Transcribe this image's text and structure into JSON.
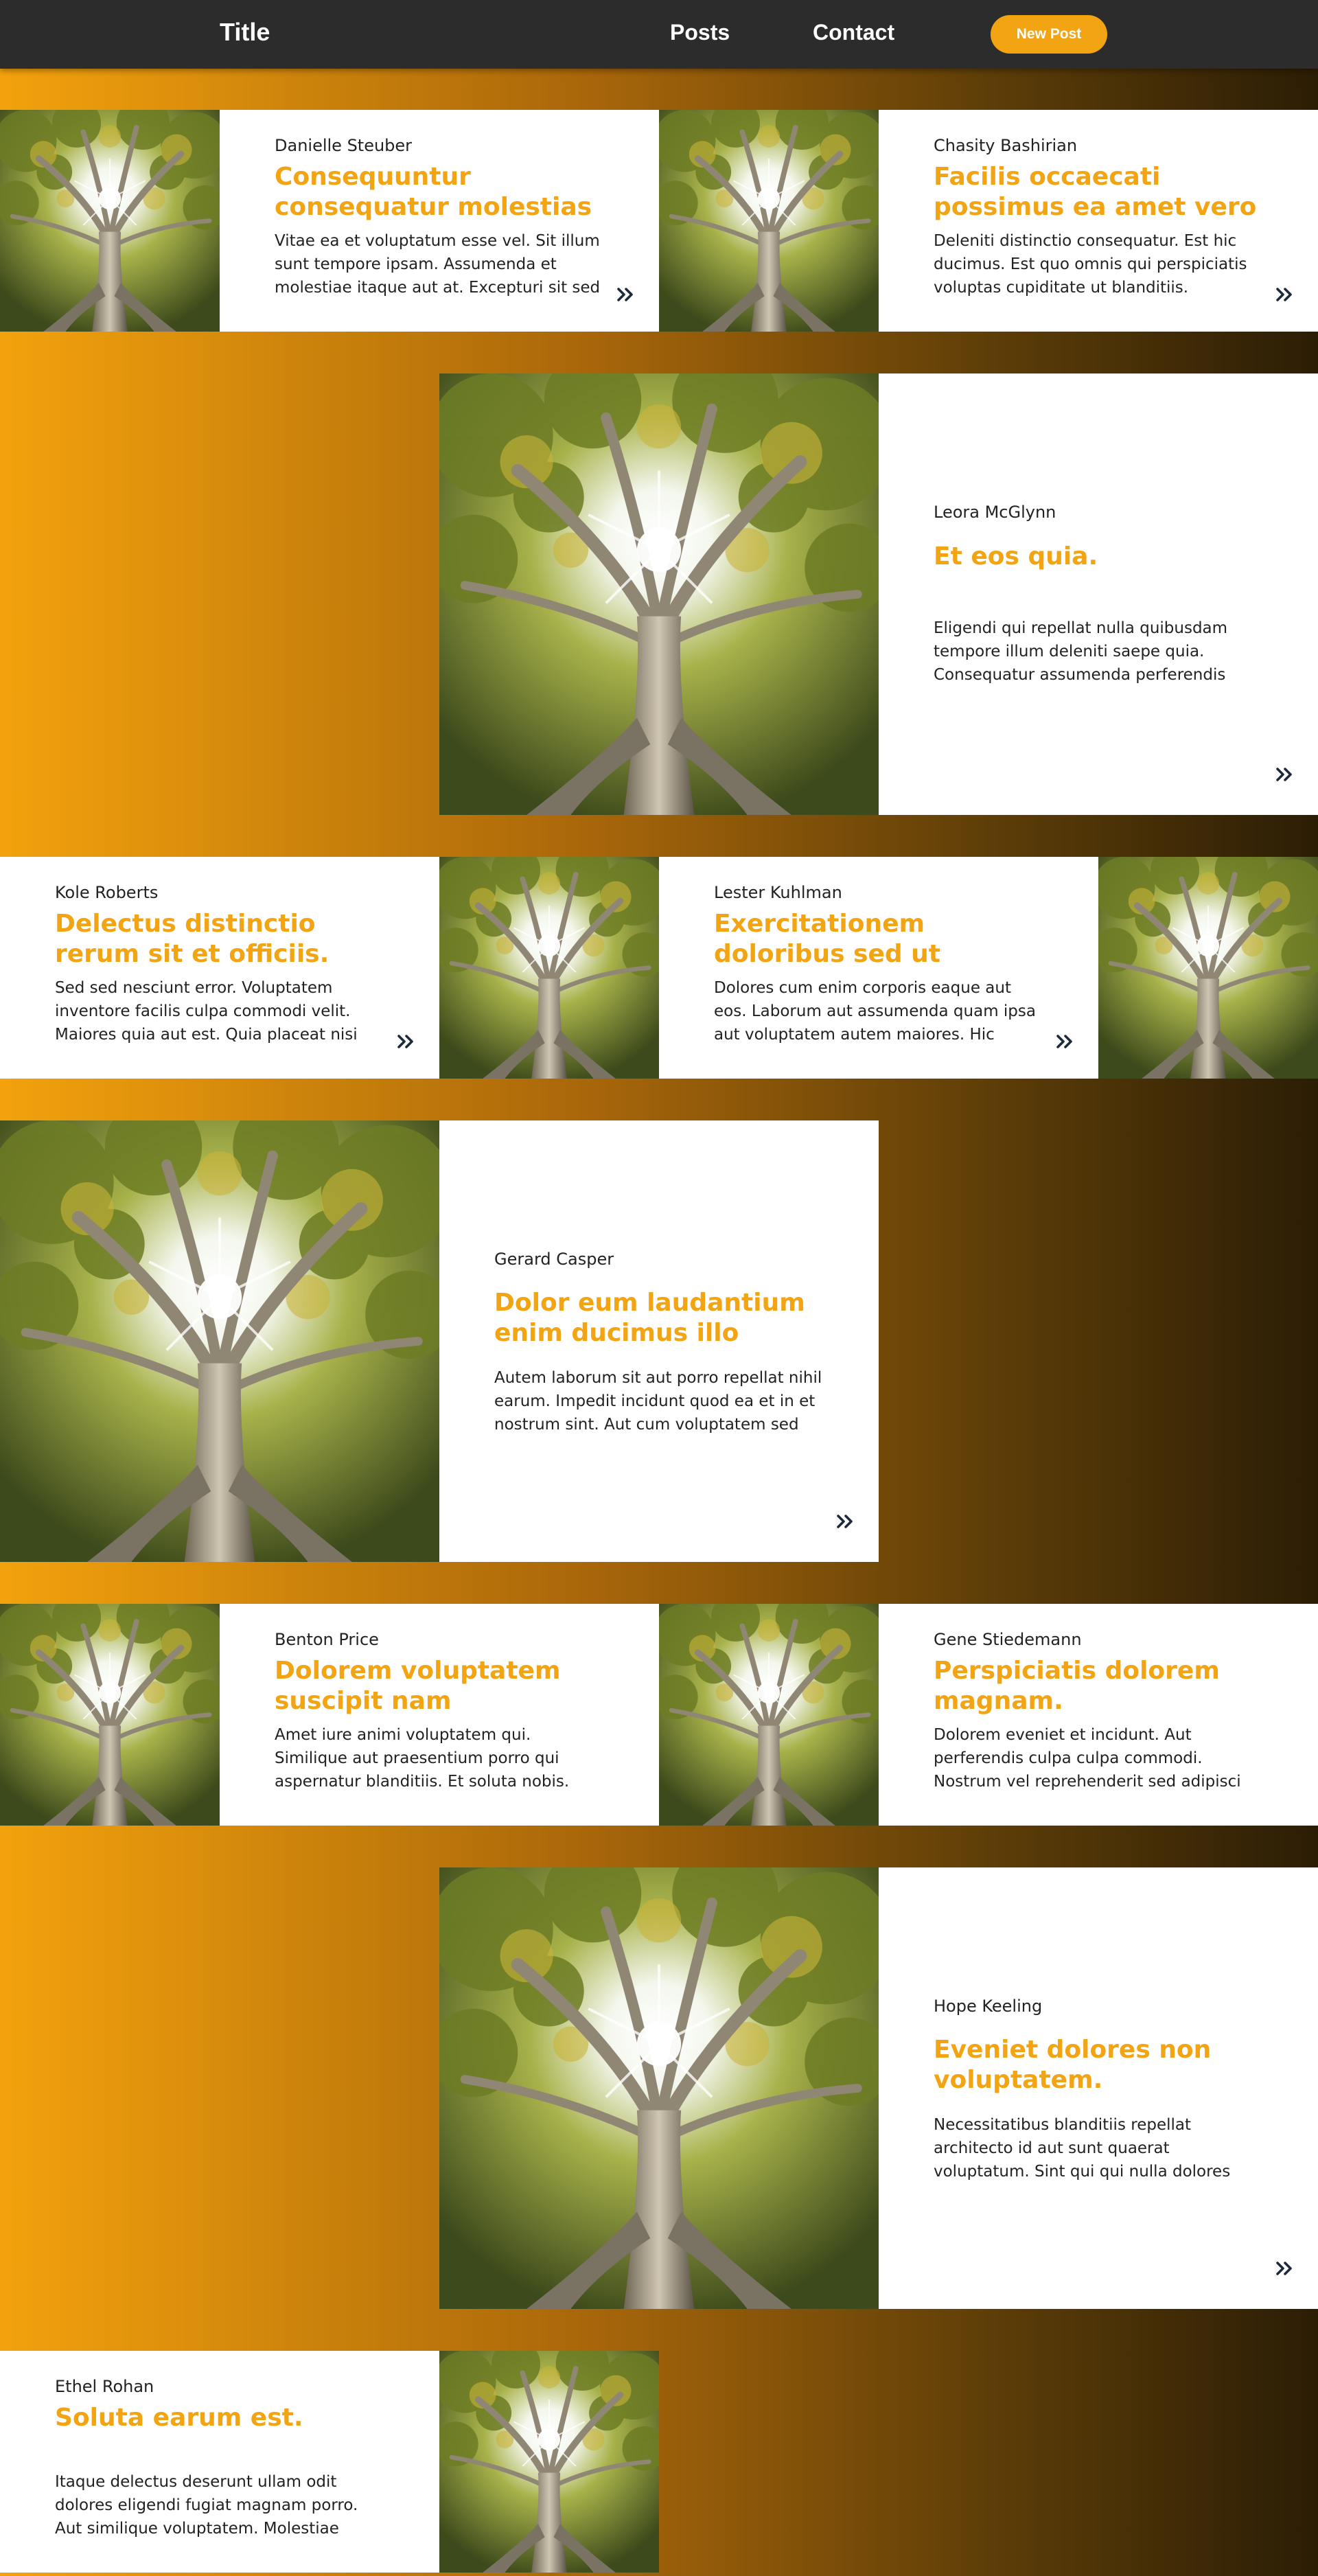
{
  "header": {
    "title": "Title",
    "nav": [
      "Posts",
      "Contact"
    ],
    "new_post_label": "New Post",
    "accent_color": "#f2a413",
    "background_color": "#2c2c2c"
  },
  "posts": [
    {
      "author": "Danielle Steuber",
      "title": "Consequuntur consequatur molestias",
      "excerpt": "Vitae ea et voluptatum esse vel. Sit illum sunt tempore ipsam. Assumenda et molestiae itaque aut at. Excepturi sit sed"
    },
    {
      "author": "Chasity Bashirian",
      "title": "Facilis occaecati possimus ea amet vero",
      "excerpt": "Deleniti distinctio consequatur. Est hic ducimus. Est quo omnis qui perspiciatis voluptas cupiditate ut blanditiis."
    },
    {
      "author": "Leora McGlynn",
      "title": "Et eos quia.",
      "excerpt": "Eligendi qui repellat nulla quibusdam tempore illum deleniti saepe quia. Consequatur assumenda perferendis"
    },
    {
      "author": "Kole Roberts",
      "title": "Delectus distinctio rerum sit et officiis.",
      "excerpt": "Sed sed nesciunt error. Voluptatem inventore facilis culpa commodi velit. Maiores quia aut est. Quia placeat nisi"
    },
    {
      "author": "Lester Kuhlman",
      "title": "Exercitationem doloribus sed ut",
      "excerpt": "Dolores cum enim corporis eaque aut eos. Laborum aut assumenda quam ipsa aut voluptatem autem maiores. Hic inventore"
    },
    {
      "author": "Gerard Casper",
      "title": "Dolor eum laudantium enim ducimus illo",
      "excerpt": "Autem laborum sit aut porro repellat nihil earum. Impedit incidunt quod ea et in et nostrum sint. Aut cum voluptatem sed qui"
    },
    {
      "author": "Benton Price",
      "title": "Dolorem voluptatem suscipit nam",
      "excerpt": "Amet iure animi voluptatem qui. Similique aut praesentium porro qui aspernatur blanditiis. Et soluta nobis. Culpa sed soluta"
    },
    {
      "author": "Gene Stiedemann",
      "title": "Perspiciatis dolorem magnam.",
      "excerpt": "Dolorem eveniet et incidunt. Aut perferendis culpa culpa commodi. Nostrum vel reprehenderit sed adipisci"
    },
    {
      "author": "Hope Keeling",
      "title": "Eveniet dolores non voluptatem.",
      "excerpt": "Necessitatibus blanditiis repellat architecto id aut sunt quaerat voluptatum. Sint qui qui nulla dolores dolorem"
    },
    {
      "author": "Ethel Rohan",
      "title": "Soluta earum est.",
      "excerpt": "Itaque delectus deserunt ullam odit dolores eligendi fugiat magnam porro. Aut similique voluptatem. Molestiae omnis"
    }
  ],
  "icons": {
    "read_more": "double-chevron-right-icon",
    "photo": "tree-photo"
  }
}
